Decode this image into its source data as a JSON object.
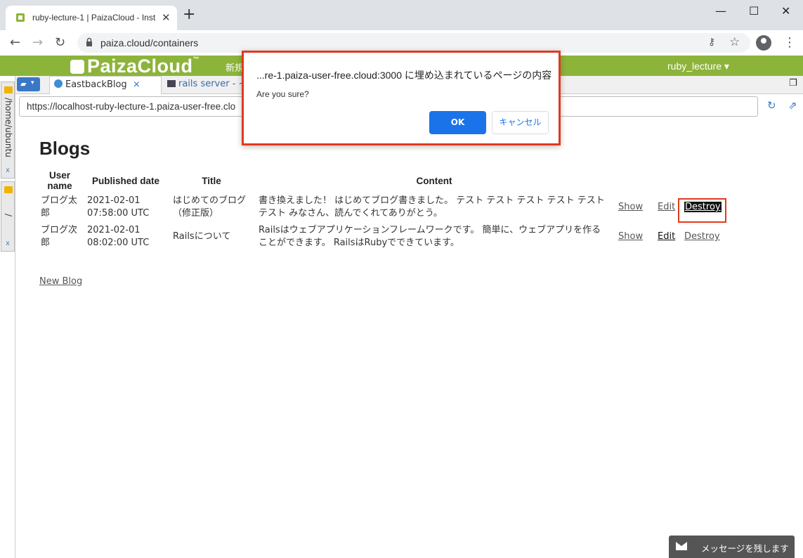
{
  "browser": {
    "tab_title": "ruby-lecture-1 | PaizaCloud - Inst",
    "tab_close": "✕",
    "new_tab": "+",
    "url": "paiza.cloud/containers",
    "window_controls": [
      "—",
      "☐",
      "✕"
    ]
  },
  "paiza": {
    "logo": "PaizaCloud",
    "tm": "™",
    "menu_new": "新規",
    "user": "ruby_lecture ▾"
  },
  "sidebar": {
    "tabs": [
      {
        "label": "/home/ubuntu",
        "close": "x"
      },
      {
        "label": "/",
        "close": "x"
      }
    ]
  },
  "inner_tabs": {
    "dropdown": "▾",
    "active": "EastbackBlog",
    "active_close": "×",
    "inactive": "rails server - ~/e"
  },
  "inner_url": "https://localhost-ruby-lecture-1.paiza-user-free.clo",
  "page": {
    "title": "Blogs",
    "headers": [
      "User name",
      "Published date",
      "Title",
      "Content"
    ],
    "header_user_line1": "User",
    "header_user_line2": "name",
    "rows": [
      {
        "user": "ブログ太郎",
        "date": "2021-02-01 07:58:00 UTC",
        "title": "はじめてのブログ（修正版）",
        "content": "書き換えました！ はじめてブログ書きました。 テスト テスト テスト テスト テスト テスト みなさん、読んでくれてありがとう。",
        "show": "Show",
        "edit": "Edit",
        "destroy": "Destroy"
      },
      {
        "user": "ブログ次郎",
        "date": "2021-02-01 08:02:00 UTC",
        "title": "Railsについて",
        "content": "Railsはウェブアプリケーションフレームワークです。 簡単に、ウェブアプリを作ることができます。 RailsはRubyでできています。",
        "show": "Show",
        "edit": "Edit",
        "destroy": "Destroy"
      }
    ],
    "new_blog": "New Blog"
  },
  "dialog": {
    "title": "...re-1.paiza-user-free.cloud:3000 に埋め込まれているページの内容",
    "message": "Are you sure?",
    "ok": "OK",
    "cancel": "キャンセル"
  },
  "message_widget": "メッセージを残します",
  "colors": {
    "paiza_green": "#8cb43a",
    "highlight_red": "#e03a1e",
    "ok_blue": "#1a73e8"
  }
}
